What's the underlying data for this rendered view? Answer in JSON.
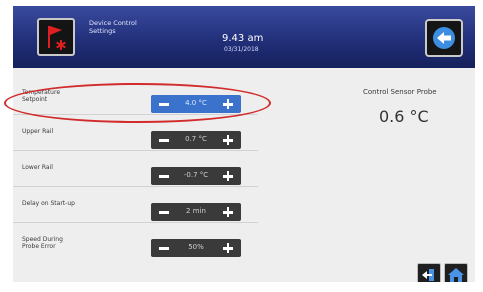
{
  "header": {
    "title_line1": "Device Control",
    "title_line2": "Settings",
    "time": "9.43 am",
    "date": "03/31/2018"
  },
  "settings": [
    {
      "label_line1": "Temperature",
      "label_line2": "Setpoint",
      "value": "4.0 °C",
      "active": true
    },
    {
      "label_line1": "Upper Rail",
      "label_line2": "",
      "value": "0.7 °C",
      "active": false
    },
    {
      "label_line1": "Lower Rail",
      "label_line2": "",
      "value": "-0.7 °C",
      "active": false
    },
    {
      "label_line1": "Delay on Start-up",
      "label_line2": "",
      "value": "2 min",
      "active": false
    },
    {
      "label_line1": "Speed During",
      "label_line2": "Probe Error",
      "value": "50%",
      "active": false
    }
  ],
  "probe": {
    "label": "Control Sensor Probe",
    "value": "0.6 °C"
  },
  "icons": {
    "top_left": "red-flag-alarm-icon",
    "top_right": "back-arrow-icon",
    "bottom_left": "exit-icon",
    "bottom_right": "home-icon"
  },
  "colors": {
    "header": "#22307a",
    "active_stepper": "#3a72cc",
    "inactive_stepper": "#3a3a3a",
    "highlight": "#d22b2b"
  }
}
